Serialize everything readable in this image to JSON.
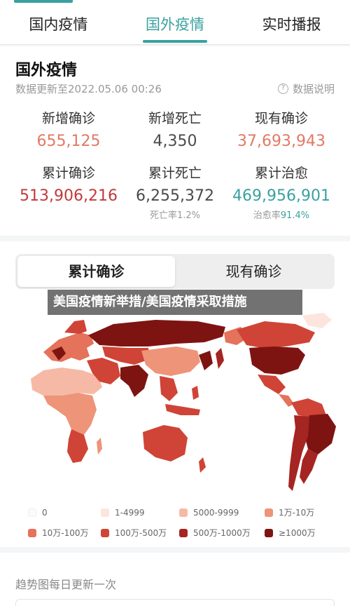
{
  "tabs": [
    {
      "label": "国内疫情"
    },
    {
      "label": "国外疫情",
      "active": true
    },
    {
      "label": "实时播报"
    }
  ],
  "stats": {
    "title": "国外疫情",
    "update": "数据更新至2022.05.06 00:26",
    "explain": "数据说明",
    "items": [
      {
        "label": "新增确诊",
        "value": "655,125",
        "color": "#e07a65"
      },
      {
        "label": "新增死亡",
        "value": "4,350",
        "color": "#4b4b4b"
      },
      {
        "label": "现有确诊",
        "value": "37,693,943",
        "color": "#e07a65"
      },
      {
        "label": "累计确诊",
        "value": "513,906,216",
        "color": "#c2393b"
      },
      {
        "label": "累计死亡",
        "value": "6,255,372",
        "color": "#4b4b4b",
        "sub_label": "死亡率",
        "sub_value": "1.2%"
      },
      {
        "label": "累计治愈",
        "value": "469,956,901",
        "color": "#3aa1a0",
        "sub_label": "治愈率",
        "sub_value": "91.4%"
      }
    ]
  },
  "segment": [
    {
      "label": "累计确诊",
      "active": true
    },
    {
      "label": "现有确诊"
    }
  ],
  "banner": "美国疫情新举措/美国疫情采取措施",
  "legend": [
    {
      "label": "0",
      "color": "#fbfbfb"
    },
    {
      "label": "1-4999",
      "color": "#fde4dc"
    },
    {
      "label": "5000-9999",
      "color": "#f6b9a6"
    },
    {
      "label": "1万-10万",
      "color": "#ee9478"
    },
    {
      "label": "10万-100万",
      "color": "#e5725a"
    },
    {
      "label": "100万-500万",
      "color": "#cf4436"
    },
    {
      "label": "500万-1000万",
      "color": "#a52522"
    },
    {
      "label": "≥1000万",
      "color": "#7e1412"
    }
  ],
  "trend": "趋势图每日更新一次"
}
